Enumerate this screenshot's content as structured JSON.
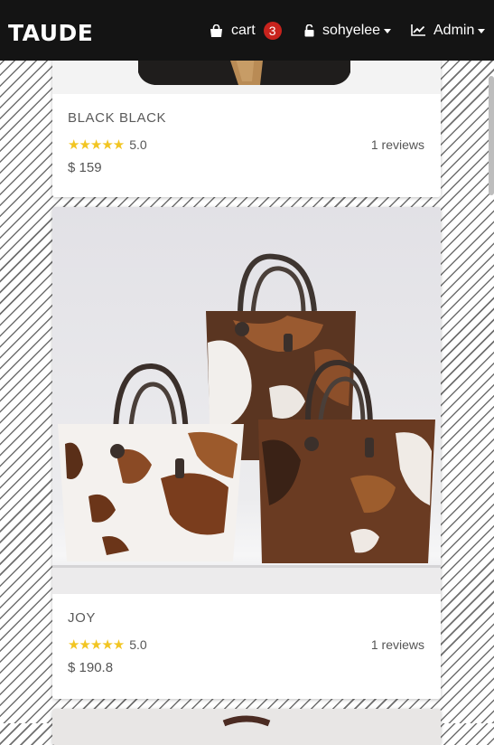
{
  "navbar": {
    "brand": "TAUDE",
    "cart": {
      "label": "cart",
      "count": "3",
      "icon": "shopping-bag-icon"
    },
    "user": {
      "label": "sohyelee",
      "icon": "unlock-icon"
    },
    "admin": {
      "label": "Admin",
      "icon": "line-chart-icon"
    }
  },
  "products": [
    {
      "title": "BLACK BLACK",
      "rating": "5.0",
      "stars": "★★★★★",
      "reviews": "1 reviews",
      "price": "$ 159"
    },
    {
      "title": "JOY",
      "rating": "5.0",
      "stars": "★★★★★",
      "reviews": "1 reviews",
      "price": "$ 190.8"
    }
  ],
  "colors": {
    "navbar": "#141414",
    "badge": "#c8231d",
    "star": "#f2c522",
    "text": "#555555"
  }
}
